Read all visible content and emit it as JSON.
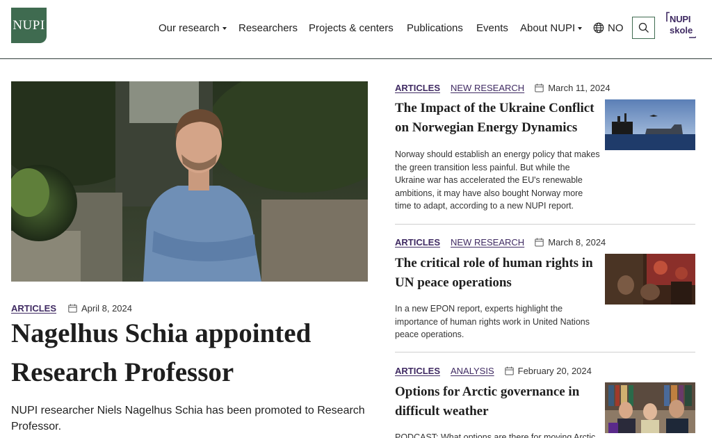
{
  "header": {
    "logo_text": "NUPI",
    "nav": [
      {
        "label": "Our research",
        "has_dropdown": true
      },
      {
        "label": "Researchers",
        "has_dropdown": false
      },
      {
        "label": "Projects & centers",
        "has_dropdown": false
      },
      {
        "label": "Publications",
        "has_dropdown": false
      },
      {
        "label": "Events",
        "has_dropdown": false
      },
      {
        "label": "About NUPI",
        "has_dropdown": true
      }
    ],
    "language": "NO",
    "search_icon": "search-icon",
    "skole_logo": {
      "line1": "NUPI",
      "line2": "skole"
    },
    "accent_color": "#3f6b50",
    "link_color": "#3f2a62"
  },
  "featured": {
    "category": "ARTICLES",
    "date": "April 8, 2024",
    "title": "Nagelhus Schia appointed Research Professor",
    "lead": "NUPI researcher Niels Nagelhus Schia has been promoted to Research Professor."
  },
  "articles": [
    {
      "category": "ARTICLES",
      "subcategory": "NEW RESEARCH",
      "date": "March 11, 2024",
      "title": "The Impact of the Ukraine Conflict on Norwegian Energy Dynamics",
      "text": "Norway should establish an energy policy that makes the green transition less painful. But while the Ukraine war has accelerated the EU's renewable ambitions, it may have also bought Norway more time to adapt, according to a new NUPI report."
    },
    {
      "category": "ARTICLES",
      "subcategory": "NEW RESEARCH",
      "date": "March 8, 2024",
      "title": "The critical role of human rights in UN peace operations",
      "text": "In a new EPON report, experts highlight the importance of human rights work in United Nations peace operations."
    },
    {
      "category": "ARTICLES",
      "subcategory": "ANALYSIS",
      "date": "February 20, 2024",
      "title": "Options for Arctic governance in difficult weather",
      "text": "PODCAST: What options are there for moving Arctic"
    }
  ]
}
